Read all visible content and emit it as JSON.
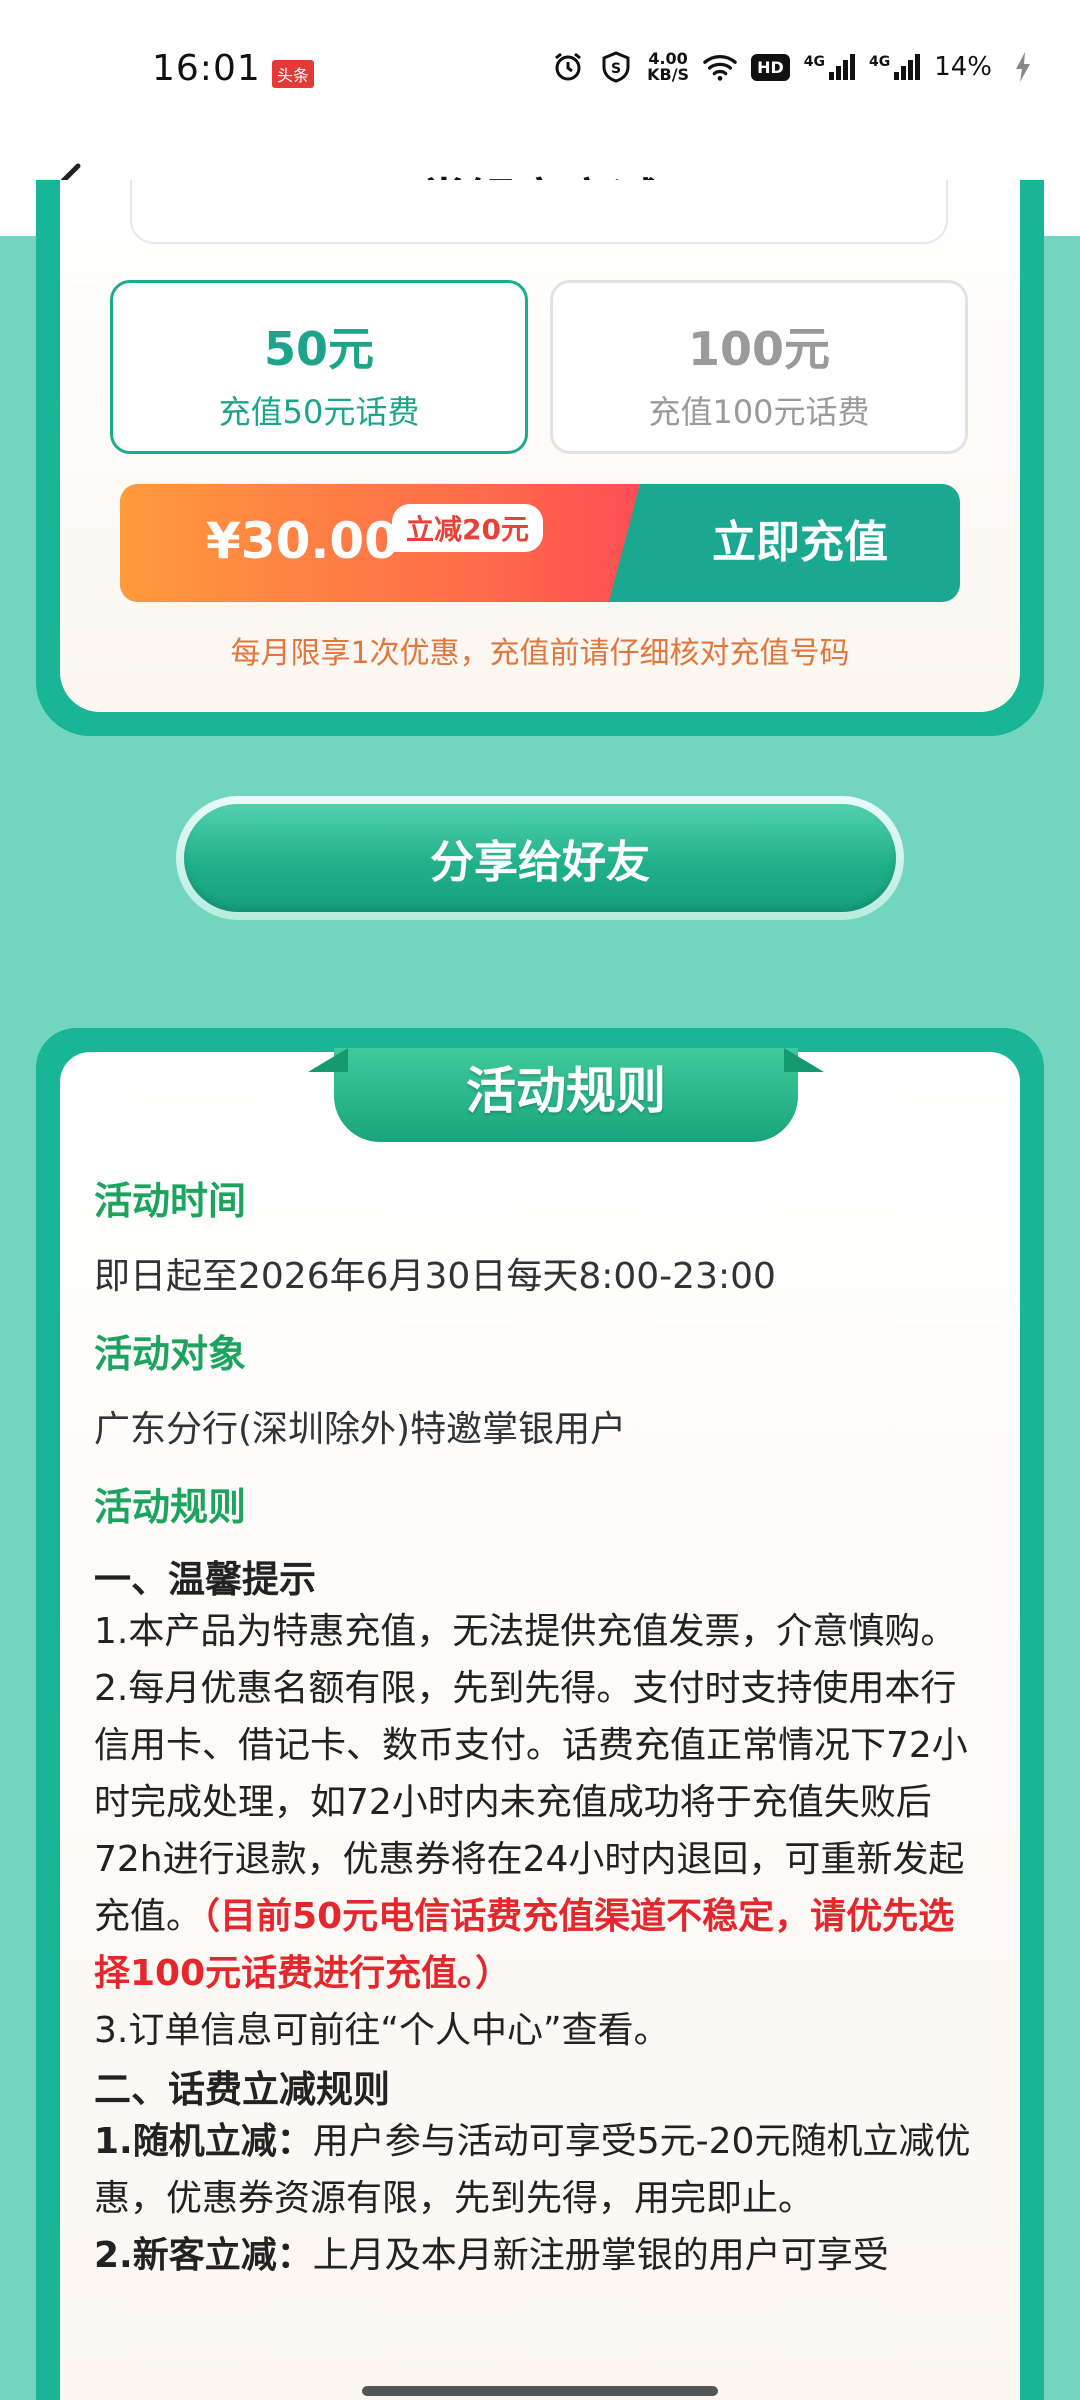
{
  "status_bar": {
    "time": "16:01",
    "badge": "头条",
    "speed_value": "4.00",
    "speed_unit": "KB/S",
    "hd_label": "HD",
    "network1": "4G",
    "network2": "4G",
    "battery": "14%"
  },
  "nav": {
    "title": "掌银享立减"
  },
  "options": [
    {
      "amount": "50元",
      "desc": "充值50元话费",
      "selected": true
    },
    {
      "amount": "100元",
      "desc": "充值100元话费",
      "selected": false
    }
  ],
  "payment": {
    "price": "¥30.00",
    "discount_tag": "立减20元",
    "button_label": "立即充值"
  },
  "notice": "每月限享1次优惠，充值前请仔细核对充值号码",
  "share_button": "分享给好友",
  "rules": {
    "title": "活动规则",
    "time_heading": "活动时间",
    "time_text": "即日起至2026年6月30日每天8:00-23:00",
    "target_heading": "活动对象",
    "target_text": "广东分行(深圳除外)特邀掌银用户",
    "rules_heading": "活动规则",
    "tips_heading": "一、温馨提示",
    "tip1": "1.本产品为特惠充值，无法提供充值发票，介意慎购。",
    "tip2": "2.每月优惠名额有限，先到先得。支付时支持使用本行信用卡、借记卡、数币支付。话费充值正常情况下72小时完成处理，如72小时内未充值成功将于充值失败后72h进行退款，优惠券将在24小时内退回，可重新发起充值。",
    "tip2_red": "（目前50元电信话费充值渠道不稳定，请优先选择100元话费进行充值。）",
    "tip3": "3.订单信息可前往“个人中心”查看。",
    "discount_heading": "二、话费立减规则",
    "random_label": "1.随机立减：",
    "random_text": "用户参与活动可享受5元-20元随机立减优惠，优惠券资源有限，先到先得，用完即止。",
    "new_label": "2.新客立减：",
    "new_text": "上月及本月新注册掌银的用户可享受"
  }
}
